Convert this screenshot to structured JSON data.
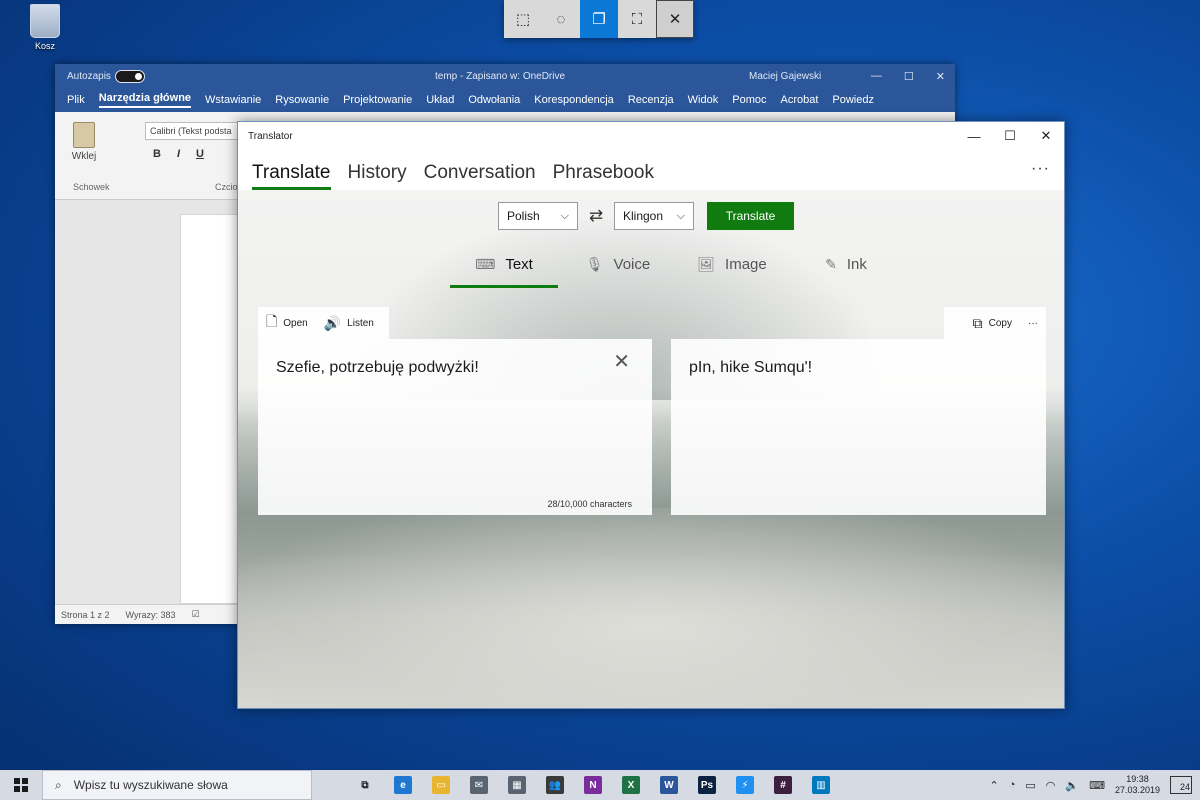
{
  "desktop": {
    "recycle_label": "Kosz"
  },
  "snip_toolbar": {
    "buttons": [
      {
        "icon": "rectangle-snip-icon",
        "glyph": "⬚"
      },
      {
        "icon": "freeform-snip-icon",
        "glyph": "◌"
      },
      {
        "icon": "window-snip-icon",
        "glyph": "❐"
      },
      {
        "icon": "fullscreen-snip-icon",
        "glyph": "⛶"
      },
      {
        "icon": "close-icon",
        "glyph": "✕"
      }
    ]
  },
  "word": {
    "autosave": "Autozapis",
    "doc_title": "temp - Zapisano w: OneDrive",
    "user": "Maciej Gajewski",
    "tabs": [
      "Plik",
      "Narzędzia główne",
      "Wstawianie",
      "Rysowanie",
      "Projektowanie",
      "Układ",
      "Odwołania",
      "Korespondencja",
      "Recenzja",
      "Widok",
      "Pomoc",
      "Acrobat",
      "Powiedz"
    ],
    "paste_label": "Wklej",
    "font_name": "Calibri (Tekst podsta",
    "clipboard_group": "Schowek",
    "font_group": "Czcio",
    "status_page": "Strona 1 z 2",
    "status_words": "Wyrazy: 383"
  },
  "translator": {
    "window_title": "Translator",
    "pivots": [
      "Translate",
      "History",
      "Conversation",
      "Phrasebook"
    ],
    "more_glyph": "···",
    "from_lang": "Polish",
    "to_lang": "Klingon",
    "translate_label": "Translate",
    "modes": [
      {
        "label": "Text",
        "icon": "keyboard-icon",
        "glyph": "⌨"
      },
      {
        "label": "Voice",
        "icon": "microphone-icon",
        "glyph": "🎙"
      },
      {
        "label": "Image",
        "icon": "image-icon",
        "glyph": "🖼"
      },
      {
        "label": "Ink",
        "icon": "pen-icon",
        "glyph": "✎"
      }
    ],
    "open_label": "Open",
    "listen_label": "Listen",
    "copy_label": "Copy",
    "source_text": "Szefie, potrzebuję podwyżki!",
    "char_count": "28/10,000 characters",
    "output_text": "pIn, hike Sumqu'!"
  },
  "taskbar": {
    "search_placeholder": "Wpisz tu wyszukiwane słowa",
    "apps": [
      {
        "name": "task-view",
        "color": "#d5dae3",
        "label": "⧉"
      },
      {
        "name": "edge",
        "color": "#1e78d2",
        "label": "e"
      },
      {
        "name": "explorer",
        "color": "#e8b530",
        "label": "▭"
      },
      {
        "name": "mail",
        "color": "#5a6470",
        "label": "✉"
      },
      {
        "name": "calendar",
        "color": "#5a6470",
        "label": "▦"
      },
      {
        "name": "people",
        "color": "#3a3a3a",
        "label": "👥"
      },
      {
        "name": "onenote",
        "color": "#7a2b9c",
        "label": "N"
      },
      {
        "name": "excel",
        "color": "#1f7244",
        "label": "X"
      },
      {
        "name": "word",
        "color": "#2b579a",
        "label": "W"
      },
      {
        "name": "photoshop",
        "color": "#0b2340",
        "label": "Ps"
      },
      {
        "name": "messenger",
        "color": "#1f8ff0",
        "label": "⚡"
      },
      {
        "name": "slack",
        "color": "#3c1f3e",
        "label": "#"
      },
      {
        "name": "trello",
        "color": "#0079bf",
        "label": "▥"
      }
    ],
    "time": "19:38",
    "date": "27.03.2019",
    "notifications": "24"
  }
}
